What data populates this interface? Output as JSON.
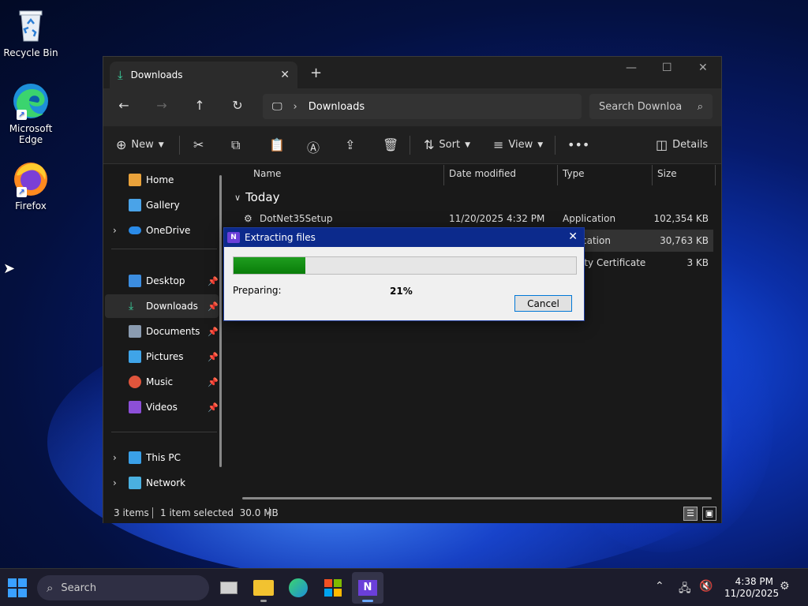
{
  "desktop": {
    "icons": [
      {
        "label": "Recycle Bin"
      },
      {
        "label": "Microsoft Edge"
      },
      {
        "label": "Firefox"
      }
    ]
  },
  "explorer": {
    "tab_title": "Downloads",
    "address_location": "Downloads",
    "search_placeholder": "Search Downloa",
    "toolbar": {
      "new_label": "New",
      "sort_label": "Sort",
      "view_label": "View",
      "details_label": "Details"
    },
    "sidebar": {
      "items": [
        {
          "label": "Home"
        },
        {
          "label": "Gallery"
        },
        {
          "label": "OneDrive"
        },
        {
          "label": "Desktop"
        },
        {
          "label": "Downloads"
        },
        {
          "label": "Documents"
        },
        {
          "label": "Pictures"
        },
        {
          "label": "Music"
        },
        {
          "label": "Videos"
        },
        {
          "label": "This PC"
        },
        {
          "label": "Network"
        }
      ]
    },
    "columns": {
      "name": "Name",
      "date": "Date modified",
      "type": "Type",
      "size": "Size"
    },
    "group_label": "Today",
    "files": [
      {
        "name": "DotNet35Setup",
        "date": "11/20/2025 4:32 PM",
        "type": "Application",
        "size": "102,354 KB"
      },
      {
        "name": "",
        "date": "",
        "type": "cation",
        "size": "30,763 KB"
      },
      {
        "name": "",
        "date": "",
        "type": "ity Certificate",
        "size": "3 KB"
      }
    ],
    "status": {
      "items": "3 items",
      "selected": "1 item selected  30.0 MB"
    }
  },
  "dialog": {
    "title": "Extracting files",
    "progress_percent": 21,
    "progress_text": "21%",
    "status_label": "Preparing:",
    "cancel_label": "Cancel"
  },
  "taskbar": {
    "search_label": "Search",
    "time": "4:38 PM",
    "date": "11/20/2025"
  }
}
